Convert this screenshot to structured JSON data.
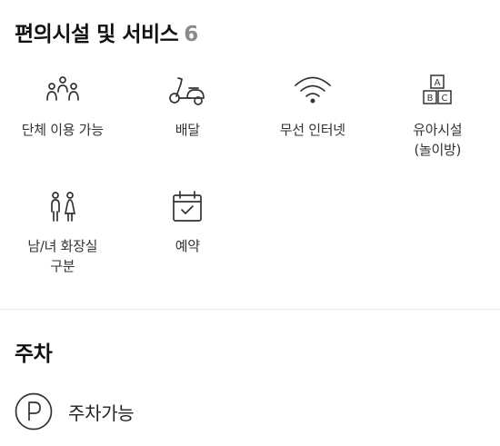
{
  "amenities": {
    "title": "편의시설 및 서비스",
    "count": "6",
    "items": [
      {
        "icon": "group-icon",
        "label": "단체 이용 가능"
      },
      {
        "icon": "delivery-scooter-icon",
        "label": "배달"
      },
      {
        "icon": "wifi-icon",
        "label": "무선 인터넷"
      },
      {
        "icon": "abc-blocks-icon",
        "label": "유아시설\n(놀이방)"
      },
      {
        "icon": "restroom-icon",
        "label": "남/녀 화장실\n구분"
      },
      {
        "icon": "calendar-check-icon",
        "label": "예약"
      }
    ]
  },
  "parking": {
    "title": "주차",
    "items": [
      {
        "icon": "parking-icon",
        "label": "주차가능"
      }
    ]
  }
}
